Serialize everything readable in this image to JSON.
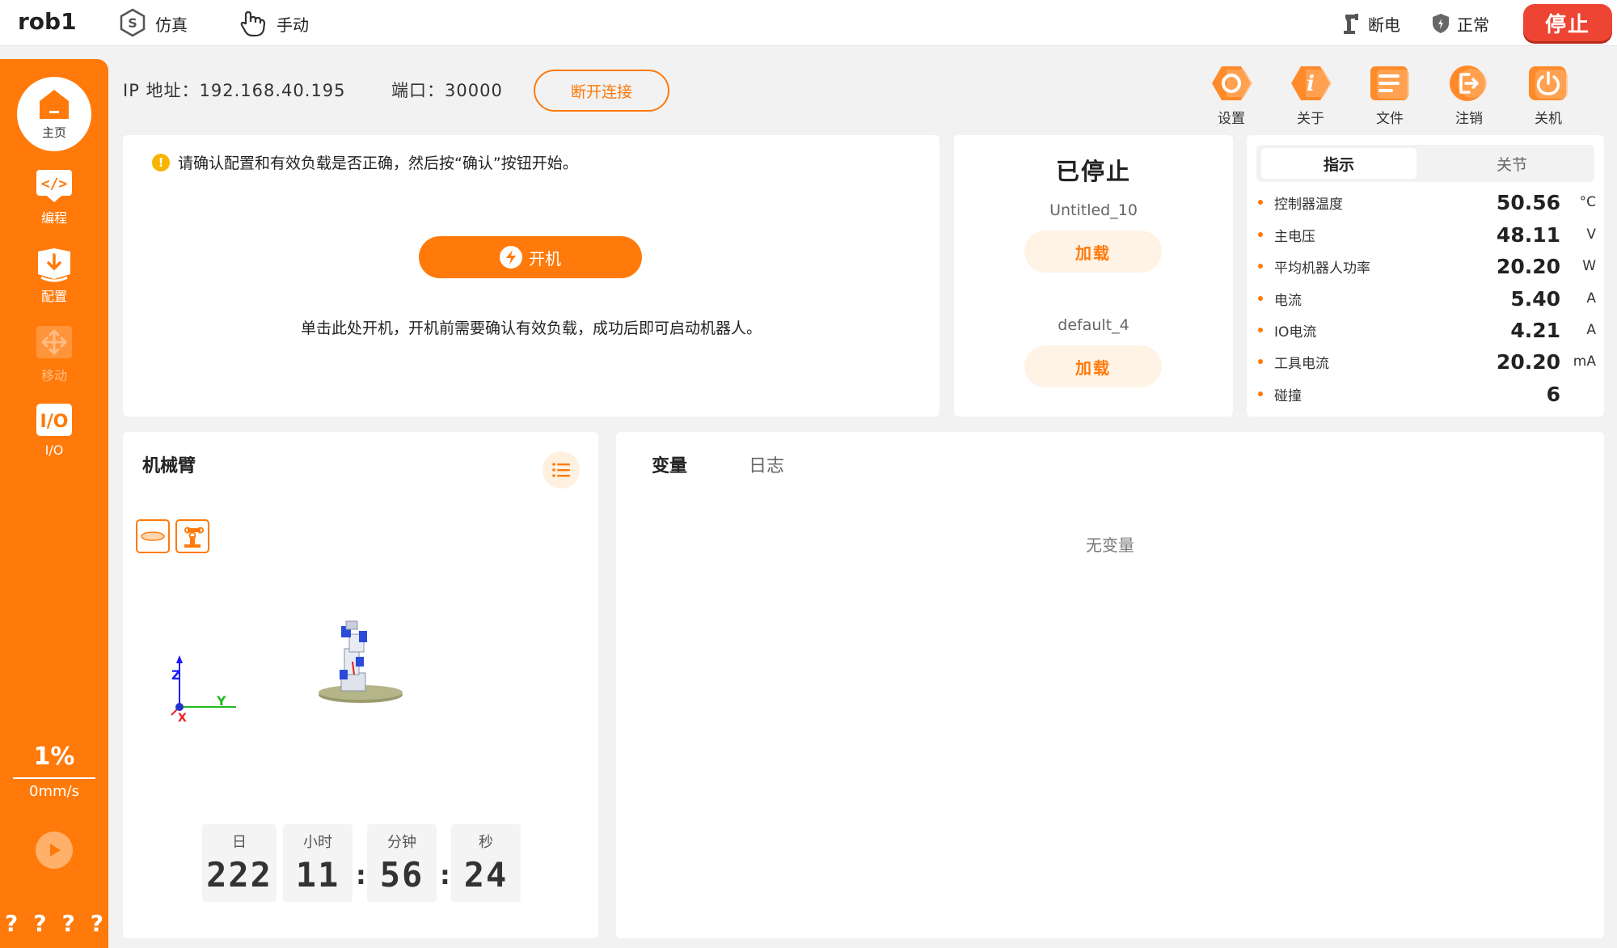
{
  "header": {
    "robot_name": "rob1",
    "mode_sim": "仿真",
    "mode_manual": "手动",
    "status_power": "断电",
    "status_state": "正常",
    "stop_label": "停止"
  },
  "sidebar": {
    "home": "主页",
    "program": "编程",
    "config": "配置",
    "move": "移动",
    "io": "I/O",
    "speed_percent": "1%",
    "speed_mm": "0mm/s",
    "question_marks": [
      "?",
      "?",
      "?",
      "?"
    ]
  },
  "connection": {
    "ip_text": "IP 地址：192.168.40.195",
    "port_text": "端口：30000",
    "disconnect_label": "断开连接"
  },
  "toolbar": {
    "settings": "设置",
    "about": "关于",
    "file": "文件",
    "logout": "注销",
    "shutdown": "关机"
  },
  "power_panel": {
    "notice": "请确认配置和有效负载是否正确，然后按“确认”按钮开始。",
    "power_on_label": "开机",
    "hint": "单击此处开机，开机前需要确认有效负载，成功后即可启动机器人。"
  },
  "program_panel": {
    "status": "已停止",
    "program_name": "Untitled_10",
    "load_label": "加载",
    "config_name": "default_4",
    "load_label_2": "加载"
  },
  "indicators": {
    "tab_active": "指示",
    "tab_joints": "关节",
    "rows": [
      {
        "name": "控制器温度",
        "value": "50.56",
        "unit": "°C"
      },
      {
        "name": "主电压",
        "value": "48.11",
        "unit": "V"
      },
      {
        "name": "平均机器人功率",
        "value": "20.20",
        "unit": "W"
      },
      {
        "name": "电流",
        "value": "5.40",
        "unit": "A"
      },
      {
        "name": "IO电流",
        "value": "4.21",
        "unit": "A"
      },
      {
        "name": "工具电流",
        "value": "20.20",
        "unit": "mA"
      },
      {
        "name": "碰撞",
        "value": "6",
        "unit": ""
      }
    ]
  },
  "arm_panel": {
    "title": "机械臂",
    "axis_z": "Z",
    "axis_x": "X",
    "axis_y": "Y",
    "timer": {
      "day_label": "日",
      "day": "222",
      "hour_label": "小时",
      "hour": "11",
      "minute_label": "分钟",
      "minute": "56",
      "second_label": "秒",
      "second": "24",
      "separator": ":"
    }
  },
  "variables_panel": {
    "tab_variables": "变量",
    "tab_log": "日志",
    "empty_text": "无变量"
  },
  "colors": {
    "accent": "#ff7a0a",
    "stop": "#ee4433",
    "warning": "#f7b500"
  }
}
